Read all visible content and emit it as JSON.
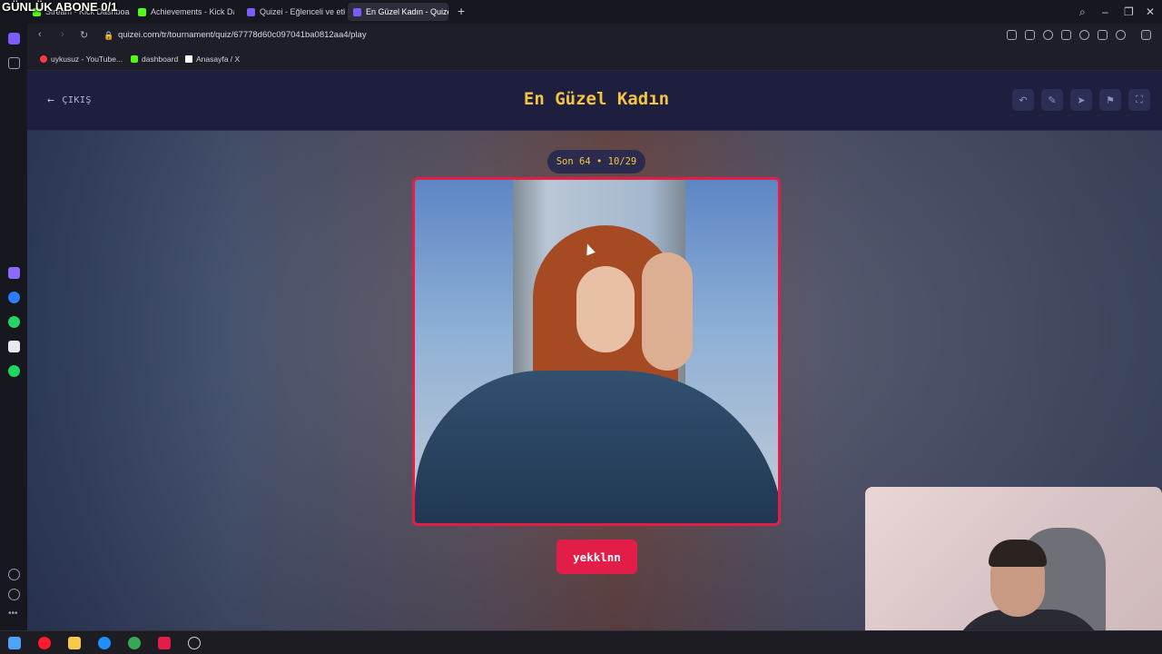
{
  "overlay": {
    "text": "GÜNLÜK ABONE 0/1"
  },
  "browser": {
    "tabs": [
      {
        "label": "Stream - Kick Dashboard",
        "active": false,
        "color": "#53fc18"
      },
      {
        "label": "Achievements - Kick Dash",
        "active": false,
        "color": "#53fc18"
      },
      {
        "label": "Quizei - Eğlenceli ve etkile",
        "active": false,
        "color": "#7c5cff"
      },
      {
        "label": "En Güzel Kadın - Quizei",
        "active": true,
        "color": "#7c5cff"
      }
    ],
    "url": "quizei.com/tr/tournament/quiz/67778d60c097041ba0812aa4/play",
    "bookmarks": [
      {
        "label": "uykusuz - YouTube...",
        "icon": "youtube-icon",
        "color": "#ff3b3b"
      },
      {
        "label": "dashboard",
        "icon": "kick-icon",
        "color": "#53fc18"
      },
      {
        "label": "Anasayfa / X",
        "icon": "x-icon",
        "color": "#ffffff"
      }
    ]
  },
  "page": {
    "exit_label": "ÇIKIŞ",
    "title": "En Güzel Kadın",
    "round_label": "Son 64 • 10/29",
    "candidate_name": "yekklnn",
    "header_actions": [
      "undo-icon",
      "edit-icon",
      "share-icon",
      "flag-icon",
      "fullscreen-icon"
    ],
    "accent": "#e11d48",
    "title_color": "#f5c542"
  }
}
